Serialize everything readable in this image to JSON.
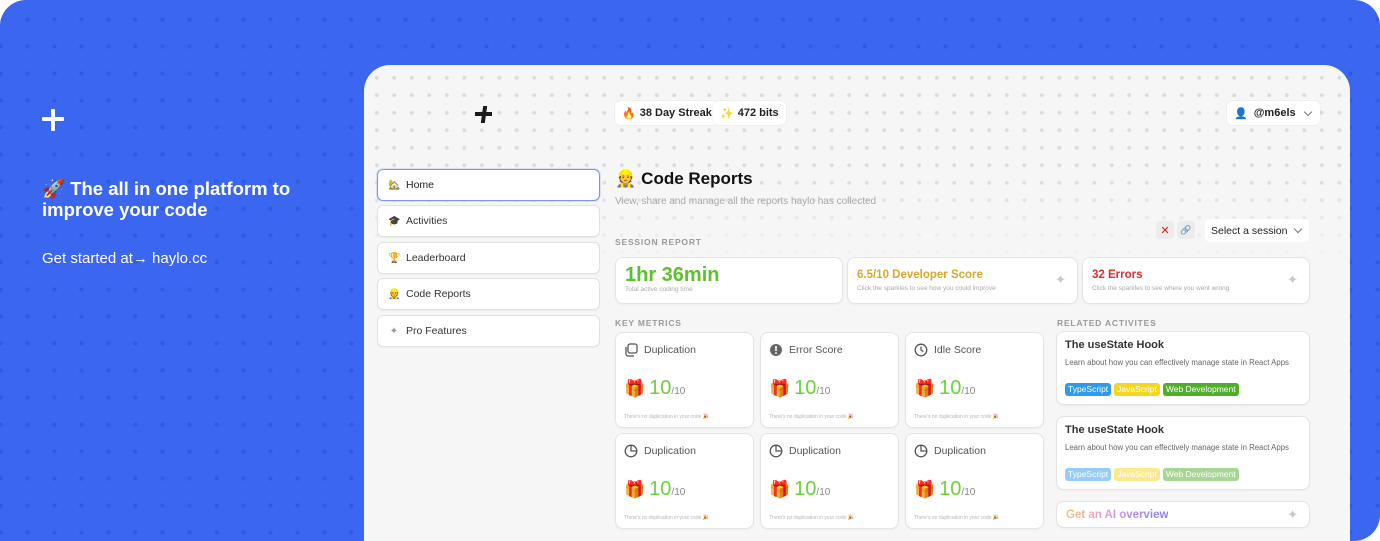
{
  "promo": {
    "logo_icon": "plus-logo-icon",
    "title_emoji": "🚀",
    "title": "The all in one platform to improve your code",
    "cta": "Get started at→ haylo.cc"
  },
  "header": {
    "logo_icon": "plus-logo-icon",
    "streak": {
      "emoji": "🔥",
      "label": "38 Day Streak"
    },
    "bits": {
      "emoji": "✨",
      "label": "472 bits"
    },
    "user": {
      "emoji": "👤",
      "handle": "@m6els"
    }
  },
  "sidebar": {
    "items": [
      {
        "emoji": "🏡",
        "label": "Home",
        "active": true
      },
      {
        "emoji": "🎓",
        "label": "Activities"
      },
      {
        "emoji": "🏆",
        "label": "Leaderboard"
      },
      {
        "emoji": "👷",
        "label": "Code Reports"
      },
      {
        "emoji": "✦",
        "label": "Pro Features"
      }
    ]
  },
  "main": {
    "title_emoji": "👷",
    "title": "Code Reports",
    "subtitle": "View, share and manage all the reports haylo has collected",
    "session_label": "SESSION REPORT",
    "close_icon": "✕",
    "link_icon": "🔗",
    "session_select": {
      "value": "Select a session"
    },
    "stats": [
      {
        "value": "1hr 36min",
        "caption": "Total active coding time",
        "color": "#5cc22a"
      },
      {
        "value": "6.5/10 Developer Score",
        "caption": "Click the sparkles to see how you could improve",
        "color": "#d9a72a"
      },
      {
        "value": "32 Errors",
        "caption": "Click the sparkles to see where you went wrong",
        "color": "#dc2e2e"
      }
    ],
    "metrics_label": "KEY METRICS",
    "metrics": [
      {
        "icon": "copy-icon",
        "label": "Duplication",
        "score": "10",
        "max": "/10",
        "note": "There's no duplication in your code 🎉"
      },
      {
        "icon": "alert-circle-icon",
        "label": "Error Score",
        "score": "10",
        "max": "/10",
        "note": "There's no duplication in your code 🎉"
      },
      {
        "icon": "clock-icon",
        "label": "Idle Score",
        "score": "10",
        "max": "/10",
        "note": "There's no duplication in your code 🎉"
      },
      {
        "icon": "pie-chart-icon",
        "label": "Duplication",
        "score": "10",
        "max": "/10",
        "note": "There's no duplication in your code 🎉"
      },
      {
        "icon": "pie-chart-icon",
        "label": "Duplication",
        "score": "10",
        "max": "/10",
        "note": "There's no duplication in your code 🎉"
      },
      {
        "icon": "pie-chart-icon",
        "label": "Duplication",
        "score": "10",
        "max": "/10",
        "note": "There's no duplication in your code 🎉"
      }
    ],
    "gift_emoji": "🎁",
    "related_label": "RELATED ACTIVITES",
    "activities": [
      {
        "title": "The useState Hook",
        "description": "Learn about how you can effectively manage state in React Apps",
        "tags": [
          {
            "label": "TypeScript",
            "color": "#2f9bf0"
          },
          {
            "label": "JavaScript",
            "color": "#f5d61e"
          },
          {
            "label": "Web Development",
            "color": "#4fae2a"
          }
        ]
      },
      {
        "title": "The useState Hook",
        "description": "Learn about how you can effectively manage state in React Apps",
        "tags": [
          {
            "label": "TypeScript",
            "color": "#2f9bf0"
          },
          {
            "label": "JavaScript",
            "color": "#f5d61e"
          },
          {
            "label": "Web Development",
            "color": "#4fae2a"
          }
        ]
      }
    ],
    "ai_overview": "Get an AI overview",
    "sparkle_glyph": "✦"
  }
}
